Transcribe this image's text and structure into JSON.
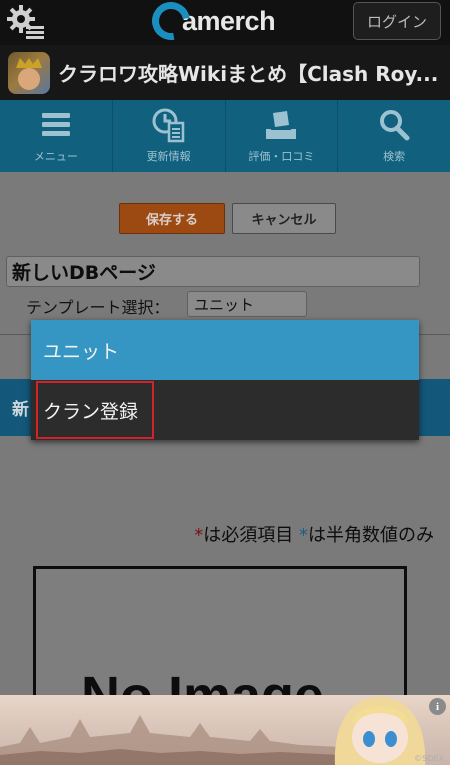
{
  "header": {
    "logo_text": "amerch",
    "login_label": "ログイン"
  },
  "titlebar": {
    "site_title": "クラロワ攻略Wikiまとめ【Clash Roy..."
  },
  "nav": {
    "items": [
      {
        "label": "メニュー",
        "icon": "menu-icon"
      },
      {
        "label": "更新情報",
        "icon": "updates-icon"
      },
      {
        "label": "評価・口コミ",
        "icon": "rating-icon"
      },
      {
        "label": "検索",
        "icon": "search-icon"
      }
    ]
  },
  "form": {
    "save_label": "保存する",
    "cancel_label": "キャンセル",
    "page_title_value": "新しいDBページ",
    "template_label": "テンプレート選択：",
    "template_selected": "ユニット",
    "section_header_partial": "新",
    "required_text": "は必須項目",
    "halfwidth_text": "は半角数値のみ",
    "star": "*",
    "no_image_text": "No Image"
  },
  "dropdown": {
    "options": [
      "ユニット",
      "クラン登録"
    ],
    "selected_index": 0,
    "highlighted_index": 1
  },
  "ad": {
    "info_icon": "i",
    "credit": "©SOEX"
  },
  "colors": {
    "nav_bg": "#11607d",
    "accent_blue": "#3596c3",
    "save_orange": "#9c4912",
    "highlight_red": "#d2232a"
  }
}
